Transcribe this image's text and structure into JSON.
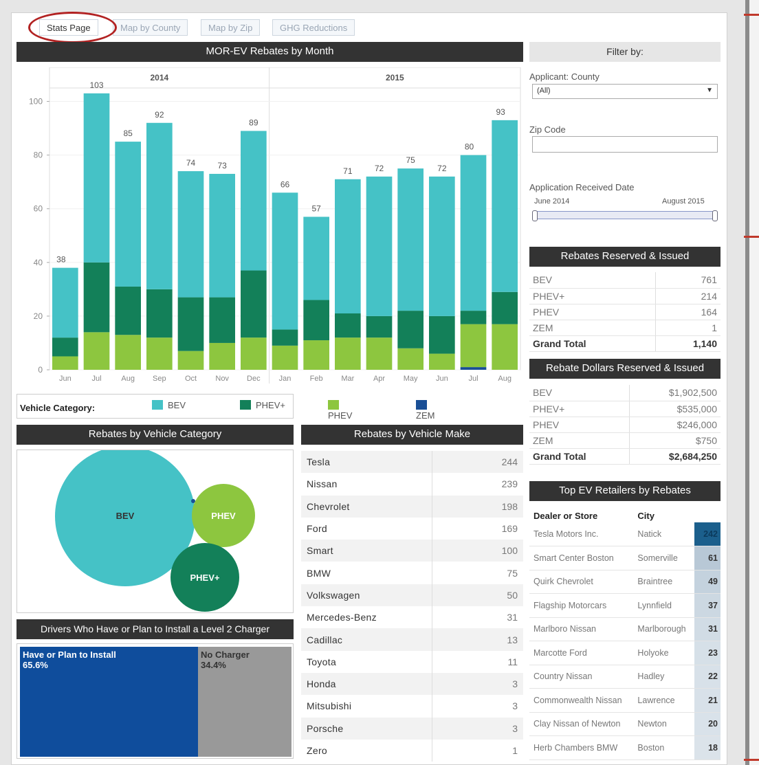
{
  "tabs": [
    "Stats Page",
    "Map by County",
    "Map by Zip",
    "GHG Reductions"
  ],
  "main_chart": {
    "title": "MOR-EV Rebates by Month",
    "years": [
      "2014",
      "2015"
    ],
    "yticks": [
      "0",
      "20",
      "40",
      "60",
      "80",
      "100"
    ],
    "months": [
      "Jun",
      "Jul",
      "Aug",
      "Sep",
      "Oct",
      "Nov",
      "Dec",
      "Jan",
      "Feb",
      "Mar",
      "Apr",
      "May",
      "Jun",
      "Jul",
      "Aug"
    ]
  },
  "chart_data": {
    "type": "bar",
    "stacked": true,
    "title": "MOR-EV Rebates by Month",
    "categories": [
      "Jun 2014",
      "Jul 2014",
      "Aug 2014",
      "Sep 2014",
      "Oct 2014",
      "Nov 2014",
      "Dec 2014",
      "Jan 2015",
      "Feb 2015",
      "Mar 2015",
      "Apr 2015",
      "May 2015",
      "Jun 2015",
      "Jul 2015",
      "Aug 2015"
    ],
    "totals": [
      38,
      103,
      85,
      92,
      74,
      73,
      89,
      66,
      57,
      71,
      72,
      75,
      72,
      80,
      93
    ],
    "series": [
      {
        "name": "ZEM",
        "color": "#1a4f96",
        "values": [
          0,
          0,
          0,
          0,
          0,
          0,
          0,
          0,
          0,
          0,
          0,
          0,
          0,
          1,
          0
        ]
      },
      {
        "name": "PHEV",
        "color": "#8dc63f",
        "values": [
          5,
          14,
          13,
          12,
          7,
          10,
          12,
          9,
          11,
          12,
          12,
          8,
          6,
          16,
          17
        ]
      },
      {
        "name": "PHEV+",
        "color": "#138059",
        "values": [
          7,
          26,
          18,
          18,
          20,
          17,
          25,
          6,
          15,
          9,
          8,
          14,
          14,
          5,
          12
        ]
      },
      {
        "name": "BEV",
        "color": "#45c2c6",
        "values": [
          26,
          63,
          54,
          62,
          47,
          46,
          52,
          51,
          31,
          50,
          52,
          53,
          52,
          58,
          64
        ]
      }
    ],
    "ylim": [
      0,
      105
    ],
    "grid": true,
    "legend": "bottom"
  },
  "legend": {
    "label": "Vehicle Category:",
    "items": [
      {
        "name": "BEV",
        "color": "#45c2c6"
      },
      {
        "name": "PHEV+",
        "color": "#138059"
      },
      {
        "name": "PHEV",
        "color": "#8dc63f"
      },
      {
        "name": "ZEM",
        "color": "#1a4f96"
      }
    ]
  },
  "category_bubbles": {
    "title": "Rebates by Vehicle Category",
    "labels": {
      "bev": "BEV",
      "phev": "PHEV",
      "phevplus": "PHEV+"
    }
  },
  "drivers": {
    "title": "Drivers Who Have or Plan to Install a Level 2 Charger",
    "have_label": "Have or Plan to Install",
    "have_pct": "65.6%",
    "none_label": "No Charger",
    "none_pct": "34.4%",
    "have_share": 0.656
  },
  "makes": {
    "title": "Rebates by Vehicle Make",
    "rows": [
      {
        "make": "Tesla",
        "count": "244"
      },
      {
        "make": "Nissan",
        "count": "239"
      },
      {
        "make": "Chevrolet",
        "count": "198"
      },
      {
        "make": "Ford",
        "count": "169"
      },
      {
        "make": "Smart",
        "count": "100"
      },
      {
        "make": "BMW",
        "count": "75"
      },
      {
        "make": "Volkswagen",
        "count": "50"
      },
      {
        "make": "Mercedes-Benz",
        "count": "31"
      },
      {
        "make": "Cadillac",
        "count": "13"
      },
      {
        "make": "Toyota",
        "count": "11"
      },
      {
        "make": "Honda",
        "count": "3"
      },
      {
        "make": "Mitsubishi",
        "count": "3"
      },
      {
        "make": "Porsche",
        "count": "3"
      },
      {
        "make": "Zero",
        "count": "1"
      }
    ]
  },
  "filter": {
    "title": "Filter by:",
    "county_label": "Applicant: County",
    "county_value": "(All)",
    "zip_label": "Zip Code",
    "zip_value": "",
    "date_label": "Application Received Date",
    "date_start": "June 2014",
    "date_end": "August 2015"
  },
  "reserved": {
    "title": "Rebates Reserved & Issued",
    "rows": [
      {
        "label": "BEV",
        "value": "761"
      },
      {
        "label": "PHEV+",
        "value": "214"
      },
      {
        "label": "PHEV",
        "value": "164"
      },
      {
        "label": "ZEM",
        "value": "1"
      }
    ],
    "total_label": "Grand Total",
    "total_value": "1,140"
  },
  "dollars": {
    "title": "Rebate Dollars Reserved & Issued",
    "rows": [
      {
        "label": "BEV",
        "value": "$1,902,500"
      },
      {
        "label": "PHEV+",
        "value": "$535,000"
      },
      {
        "label": "PHEV",
        "value": "$246,000"
      },
      {
        "label": "ZEM",
        "value": "$750"
      }
    ],
    "total_label": "Grand Total",
    "total_value": "$2,684,250"
  },
  "retailers": {
    "title": "Top EV Retailers by Rebates",
    "col_dealer": "Dealer or Store",
    "col_city": "City",
    "rows": [
      {
        "dealer": "Tesla Motors Inc.",
        "city": "Natick",
        "value": "242",
        "shade": "#1b5f8c"
      },
      {
        "dealer": "Smart Center Boston",
        "city": "Somerville",
        "value": "61",
        "shade": "#b8c8d6"
      },
      {
        "dealer": "Quirk Chevrolet",
        "city": "Braintree",
        "value": "49",
        "shade": "#c4d2de"
      },
      {
        "dealer": "Flagship Motorcars",
        "city": "Lynnfield",
        "value": "37",
        "shade": "#ccd8e2"
      },
      {
        "dealer": "Marlboro Nissan",
        "city": "Marlborough",
        "value": "31",
        "shade": "#d1dce5"
      },
      {
        "dealer": "Marcotte Ford",
        "city": "Holyoke",
        "value": "23",
        "shade": "#d6e0e8"
      },
      {
        "dealer": "Country Nissan",
        "city": "Hadley",
        "value": "22",
        "shade": "#d8e1e9"
      },
      {
        "dealer": "Commonwealth Nissan",
        "city": "Lawrence",
        "value": "21",
        "shade": "#d8e1e9"
      },
      {
        "dealer": "Clay Nissan of Newton",
        "city": "Newton",
        "value": "20",
        "shade": "#d9e2ea"
      },
      {
        "dealer": "Herb Chambers BMW",
        "city": "Boston",
        "value": "18",
        "shade": "#dbe3ea"
      }
    ]
  }
}
